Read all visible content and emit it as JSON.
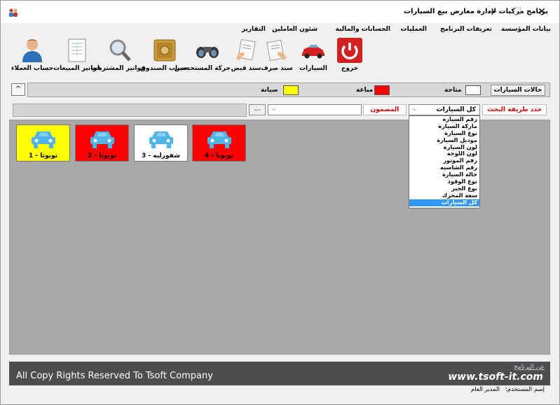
{
  "window": {
    "title": "برنامج مركبات لإدارة معارض بيع السيارات",
    "minimize": "—",
    "maximize": "☐",
    "close": "✕"
  },
  "menu": [
    "بيانات المؤسسة",
    "تعريفات البرنامج",
    "العمليات",
    "الحسابات والمالية",
    "شئون العاملين",
    "التقارير"
  ],
  "toolbar": [
    {
      "label": "خروج",
      "icon": "power-icon"
    },
    {
      "label": "السيارات",
      "icon": "car-icon"
    },
    {
      "label": "سند صرف",
      "icon": "payment-voucher-icon"
    },
    {
      "label": "سند قبض",
      "icon": "receipt-voucher-icon"
    },
    {
      "label": "حركة المستخدمين",
      "icon": "binoculars-icon"
    },
    {
      "label": "حساب الصندوق",
      "icon": "safe-icon"
    },
    {
      "label": "فواتير المشتريات",
      "icon": "magnifier-icon"
    },
    {
      "label": "فواتير المبيعات",
      "icon": "invoice-icon"
    },
    {
      "label": "حساب العملاء",
      "icon": "customer-icon"
    }
  ],
  "status": {
    "collapse": "^",
    "button": "حالات السيارات",
    "available": "متاحة",
    "sold": "مباعة",
    "maintenance": "صيانة",
    "colors": {
      "available": "#ffffff",
      "sold": "#ff0000",
      "maintenance": "#ffff00"
    }
  },
  "search": {
    "method_label": "حدد طريقة البحث",
    "selected_field": "كل السيارات",
    "content_label": "المضمون",
    "content_value": "",
    "dots": "..."
  },
  "dropdown_options": [
    "رقم السيارة",
    "ماركة السيارة",
    "نوع السيارة",
    "موديل السيارة",
    "لون السيارة",
    "لون اللوحة",
    "رقم الموتور",
    "رقم الشاسيه",
    "حالة السيارة",
    "نوع الوقود",
    "نوع الجير",
    "سعة المحرك",
    "كل السيارات"
  ],
  "cars": [
    {
      "name": "تويوتا - 1",
      "color": "#ffff00"
    },
    {
      "name": "تويوتا - 2",
      "color": "#ff0000"
    },
    {
      "name": "شفورليه - 3",
      "color": "#ffffff"
    },
    {
      "name": "تويوتا - 4",
      "color": "#ff0000"
    }
  ],
  "footer": {
    "about": "عن البرنامج",
    "copyright": "All Copy Rights Reserved To Tsoft Company",
    "website": "www.tsoft-it.com"
  },
  "user": {
    "label": "إسم المستخدم:",
    "value": "المدير العام"
  }
}
